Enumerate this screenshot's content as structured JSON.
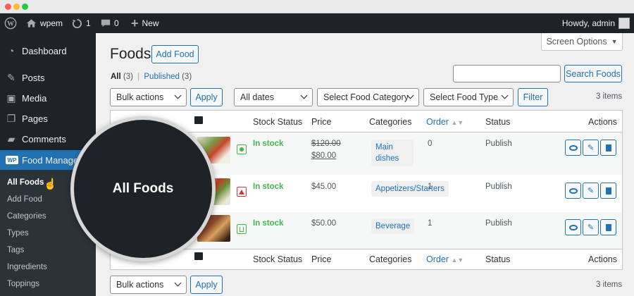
{
  "adminbar": {
    "site_name": "wpem",
    "updates_count": "1",
    "comments_count": "0",
    "new_label": "New",
    "howdy": "Howdy, admin"
  },
  "sidebar": {
    "items": [
      {
        "label": "Dashboard",
        "icon": "dashboard-icon"
      },
      {
        "label": "Posts",
        "icon": "pin-icon"
      },
      {
        "label": "Media",
        "icon": "media-icon"
      },
      {
        "label": "Pages",
        "icon": "pages-icon"
      },
      {
        "label": "Comments",
        "icon": "comment-icon"
      },
      {
        "label": "Food Manager",
        "icon": "wp-food-icon"
      }
    ],
    "submenu": [
      "All Foods",
      "Add Food",
      "Categories",
      "Types",
      "Tags",
      "Ingredients",
      "Toppings"
    ]
  },
  "page": {
    "title": "Foods",
    "add_button": "Add Food",
    "screen_options": "Screen Options",
    "filter_all": "All",
    "filter_all_count": "(3)",
    "filter_sep": "|",
    "filter_published": "Published",
    "filter_published_count": "(3)",
    "search_button": "Search Foods",
    "bulk_actions": "Bulk actions",
    "apply": "Apply",
    "all_dates": "All dates",
    "food_category": "Select Food Category",
    "food_type": "Select Food Type",
    "filter_button": "Filter",
    "items_count": "3 items"
  },
  "table": {
    "headers": {
      "stock": "Stock Status",
      "price": "Price",
      "categories": "Categories",
      "order": "Order",
      "status": "Status",
      "actions": "Actions"
    },
    "rows": [
      {
        "stock": "In stock",
        "price_old": "$120.00",
        "price_new": "$80.00",
        "category": "Main dishes",
        "order": "0",
        "status": "Publish",
        "type_color": "#46b450"
      },
      {
        "stock": "In stock",
        "price": "$45.00",
        "category": "Appetizers/Starters",
        "order": "1",
        "status": "Publish",
        "type_color": "#d63638"
      },
      {
        "stock": "In stock",
        "price": "$50.00",
        "category": "Beverage",
        "order": "1",
        "status": "Publish",
        "type_color": "#46b450"
      }
    ]
  },
  "magnifier": {
    "label": "All Foods"
  },
  "colors": {
    "accent": "#2271b1",
    "sidebar": "#1d2327",
    "instock": "#46b450"
  }
}
